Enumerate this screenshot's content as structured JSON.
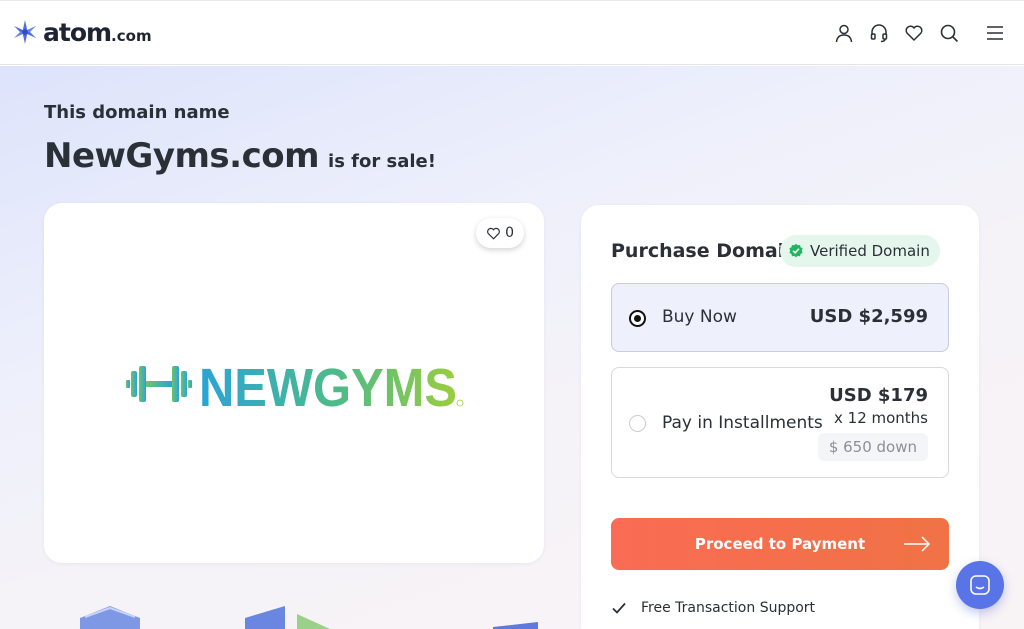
{
  "header": {
    "logo_text": "atom",
    "logo_tld": ".com",
    "icons": [
      "user-icon",
      "headset-icon",
      "heart-icon",
      "search-icon",
      "menu-icon"
    ]
  },
  "hero": {
    "eyebrow": "This domain name",
    "domain": "NewGyms.com",
    "for_sale": "is for sale!"
  },
  "logo_card": {
    "likes": "0",
    "brand_text": "NEWGYMS"
  },
  "purchase": {
    "title": "Purchase Domain",
    "verified_label": "Verified Domain",
    "buy_now": {
      "label": "Buy Now",
      "price": "USD $2,599",
      "selected": true
    },
    "installments": {
      "label": "Pay in Installments",
      "price": "USD $179",
      "months": "x 12 months",
      "down": "$ 650 down",
      "selected": false
    },
    "proceed_label": "Proceed to Payment",
    "support_text": "Free Transaction Support"
  },
  "colors": {
    "accent": "#f06a50",
    "verified_bg": "#e5f6ec",
    "verified_check": "#22b560",
    "brand_blue": "#5874e6"
  }
}
